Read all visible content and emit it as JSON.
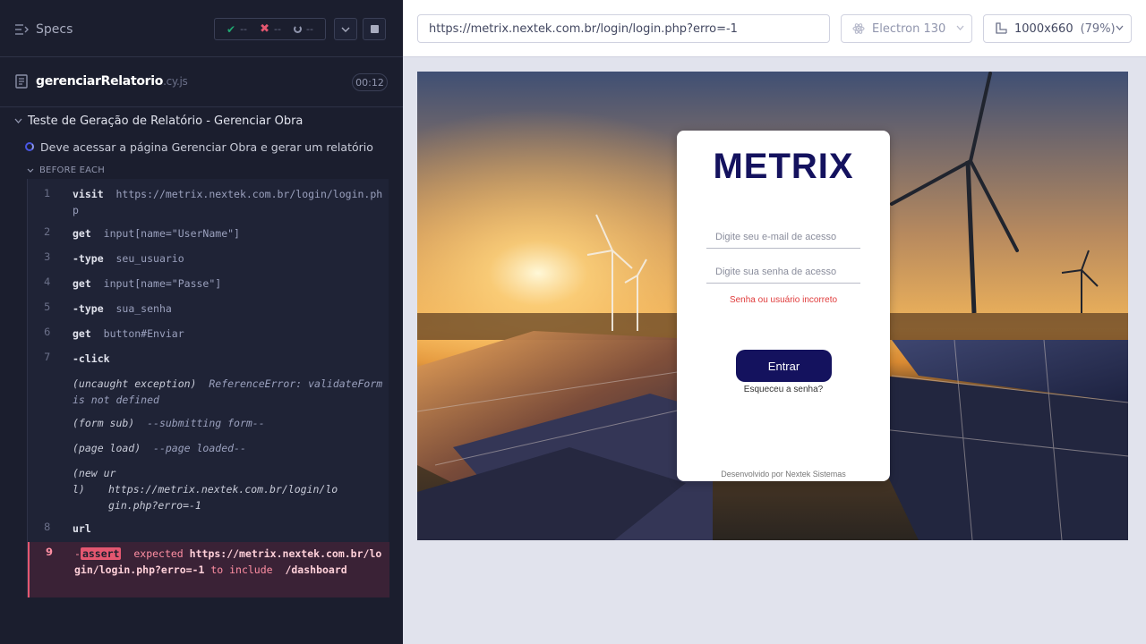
{
  "reporter": {
    "specs_label": "Specs",
    "stats": {
      "passed": "--",
      "failed": "--",
      "pending": "--"
    },
    "file": {
      "name": "gerenciarRelatorio",
      "ext": ".cy.js",
      "duration": "00:12"
    },
    "suite_title": "Teste de Geração de Relatório - Gerenciar Obra",
    "test_title": "Deve acessar a página Gerenciar Obra e gerar um relatório",
    "hook_title": "BEFORE EACH",
    "commands": [
      {
        "num": "1",
        "name": "visit",
        "arg": "https://metrix.nextek.com.br/login/login.php"
      },
      {
        "num": "2",
        "name": "get",
        "arg": "input[name=\"UserName\"]"
      },
      {
        "num": "3",
        "name": "-type",
        "arg": "seu_usuario"
      },
      {
        "num": "4",
        "name": "get",
        "arg": "input[name=\"Passe\"]"
      },
      {
        "num": "5",
        "name": "-type",
        "arg": "sua_senha"
      },
      {
        "num": "6",
        "name": "get",
        "arg": "button#Enviar"
      },
      {
        "num": "7",
        "name": "-click",
        "arg": ""
      },
      {
        "num": "8",
        "name": "url",
        "arg": ""
      }
    ],
    "events": [
      {
        "name": "(uncaught exception)",
        "arg": "ReferenceError: validateForm is not defined"
      },
      {
        "name": "(form sub)",
        "arg": "--submitting form--"
      },
      {
        "name": "(page load)",
        "arg": "--page loaded--"
      },
      {
        "name": "(new url)",
        "arg": "https://metrix.nextek.com.br/login/login.php?erro=-1"
      }
    ],
    "failed": {
      "num": "9",
      "prefix": "-",
      "badge": "assert",
      "expected": "expected",
      "value": "https://metrix.nextek.com.br/login/login.php?erro=-1",
      "to_include": "to include",
      "target": "/dashboard"
    }
  },
  "aut": {
    "url": "https://metrix.nextek.com.br/login/login.php?erro=-1",
    "browser": "Electron 130",
    "viewport": "1000x660",
    "zoom": "(79%)",
    "login": {
      "logo": "METRIX",
      "email_placeholder": "Digite seu e-mail de acesso",
      "password_placeholder": "Digite sua senha de acesso",
      "error": "Senha ou usuário incorreto",
      "submit": "Entrar",
      "forgot": "Esqueceu a senha?",
      "footer": "Desenvolvido por Nextek Sistemas"
    }
  },
  "colors": {
    "panel_bg": "#1b1e2e",
    "fail": "#e45770",
    "pass": "#1fa971",
    "brand": "#14125e"
  }
}
